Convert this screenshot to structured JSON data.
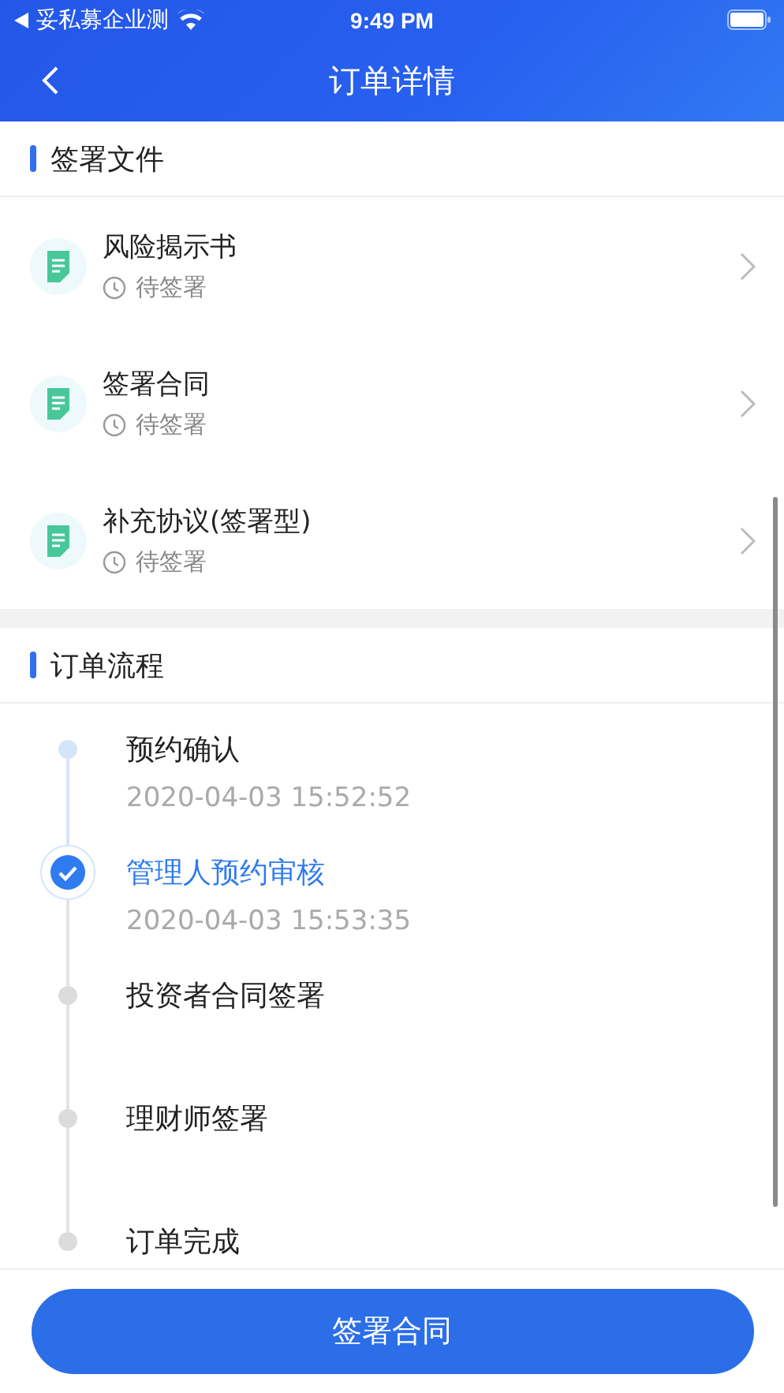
{
  "status_bar": {
    "app": "妥私募企业测",
    "time": "9:49 PM"
  },
  "nav": {
    "title": "订单详情"
  },
  "documents": {
    "title": "签署文件",
    "items": [
      {
        "name": "风险揭示书",
        "status": "待签署"
      },
      {
        "name": "签署合同",
        "status": "待签署"
      },
      {
        "name": "补充协议(签署型)",
        "status": "待签署"
      }
    ]
  },
  "flow": {
    "title": "订单流程",
    "steps": [
      {
        "name": "预约确认",
        "time": "2020-04-03 15:52:52",
        "done": true,
        "selected": false
      },
      {
        "name": "管理人预约审核",
        "time": "2020-04-03 15:53:35",
        "done": false,
        "selected": true
      },
      {
        "name": "投资者合同签署",
        "done": false,
        "selected": false
      },
      {
        "name": "理财师签署",
        "done": false,
        "selected": false
      },
      {
        "name": "订单完成",
        "done": false,
        "selected": false
      }
    ]
  },
  "action_button": "签署合同"
}
